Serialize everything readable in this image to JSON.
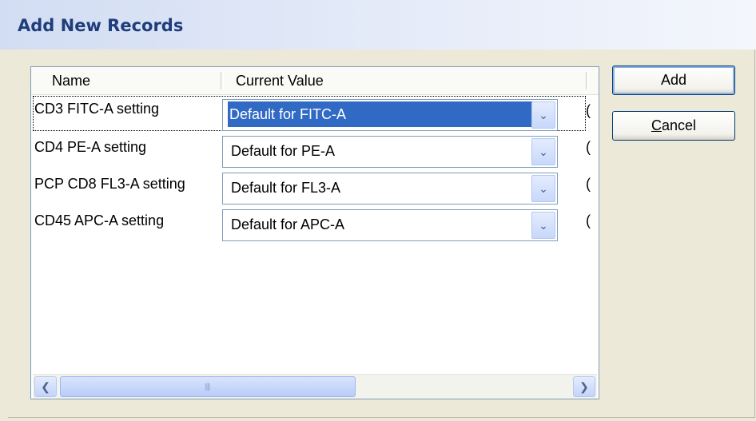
{
  "window": {
    "title": "Add New Records"
  },
  "grid": {
    "columns": [
      "Name",
      "Current Value"
    ],
    "rows": [
      {
        "name": "CD3 FITC-A setting",
        "value": "Default for FITC-A",
        "cut": "("
      },
      {
        "name": "CD4 PE-A setting",
        "value": "Default for PE-A",
        "cut": "("
      },
      {
        "name": "PCP CD8 FL3-A setting",
        "value": "Default for FL3-A",
        "cut": "("
      },
      {
        "name": "CD45 APC-A setting",
        "value": "Default for APC-A",
        "cut": "("
      }
    ],
    "scrollbar": {
      "grip": "||||"
    }
  },
  "buttons": {
    "add": "Add",
    "cancel_prefix": "C",
    "cancel_rest": "ancel"
  },
  "icons": {
    "dropdown": "chevron-down-icon",
    "scroll_left": "arrow-left-icon",
    "scroll_right": "arrow-right-icon"
  },
  "colors": {
    "selection": "#316ac5",
    "title_text": "#1f3d7a"
  }
}
